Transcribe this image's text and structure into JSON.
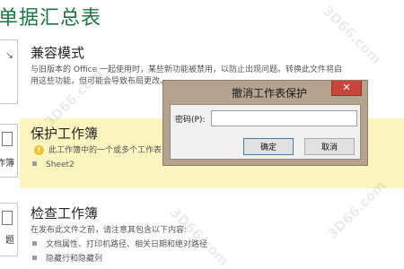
{
  "header": {
    "title": "单据汇总表"
  },
  "sections": {
    "compat": {
      "heading": "兼容模式",
      "description_line1": "与旧版本的 Office 一起使用时，某些新功能被禁用，以防止出现问题。转换此文件将启",
      "description_line2": "用这些功能，但可能会导致布局更改。"
    },
    "protect": {
      "tile_label": "作簿",
      "heading": "保护工作簿",
      "description": "此工作簿中的一个或多个工作表",
      "info_icon": "!",
      "items": [
        "Sheet2"
      ]
    },
    "inspect": {
      "tile_label": "题",
      "heading": "检查工作簿",
      "description": "在发布此文件之前，请注意其包含以下内容:",
      "items": [
        "文档属性、打印机路径、相关日期和绝对路径",
        "隐藏行和隐藏列"
      ]
    }
  },
  "dialog": {
    "title": "撤消工作表保护",
    "close_glyph": "✕",
    "password_label": "密码(P):",
    "password_value": "",
    "ok_label": "确定",
    "cancel_label": "取消"
  },
  "icons": {
    "compat_tile": "arrow-icon",
    "protect_tile": "lock-workbook-icon",
    "inspect_tile": "document-check-icon",
    "info": "warning-info-icon",
    "close": "close-icon"
  },
  "colors": {
    "title_green": "#217346",
    "highlight_band": "#fdf5bf",
    "dialog_frame": "#b5a28f",
    "close_red": "#c8453b"
  },
  "watermark": {
    "text": "3D66.com"
  }
}
